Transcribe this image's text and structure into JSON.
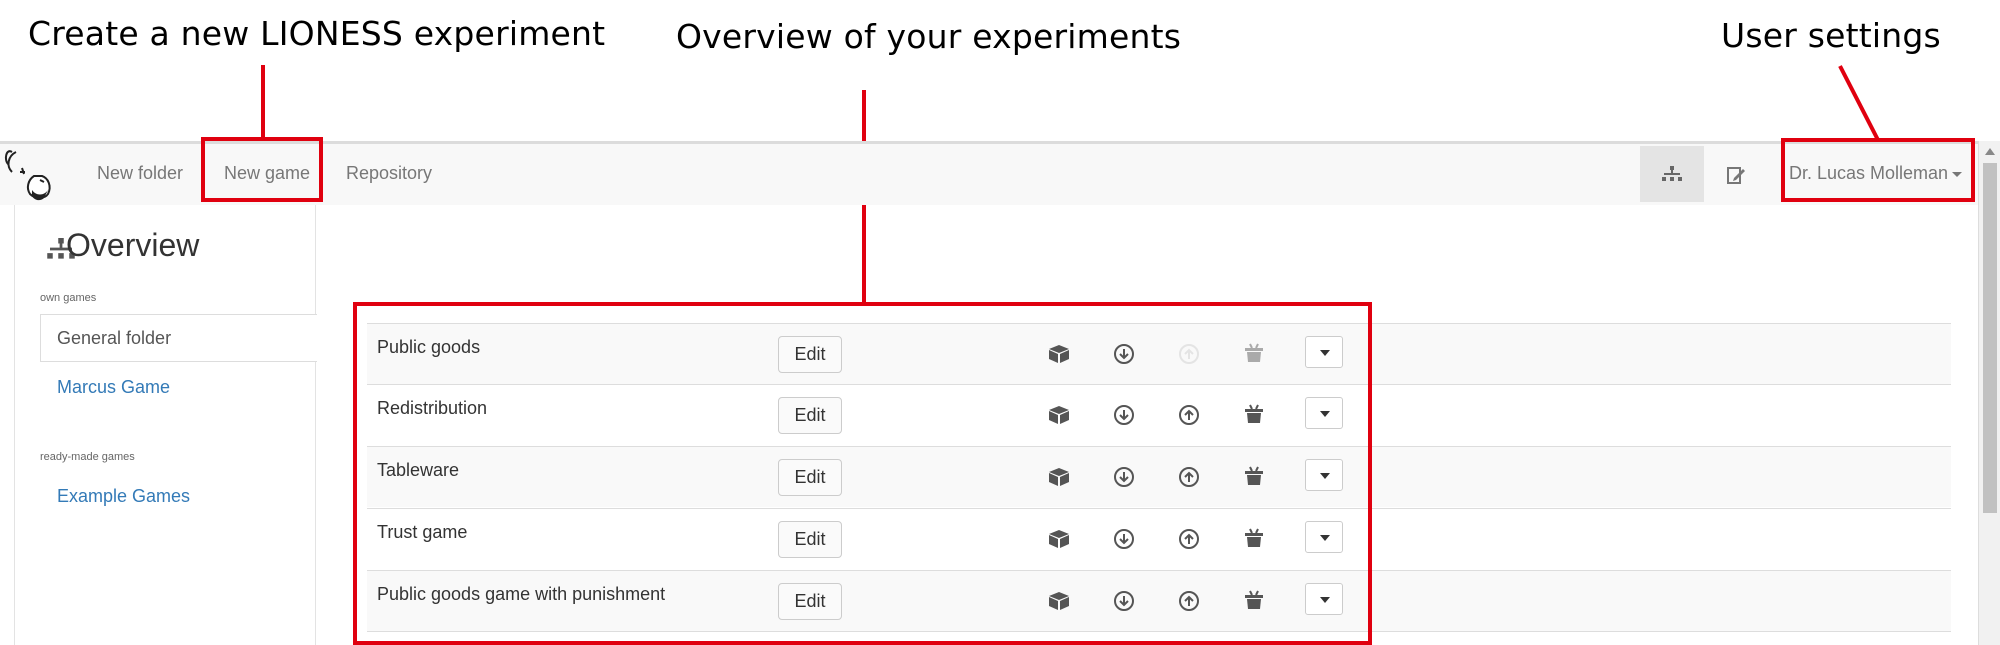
{
  "annotations": {
    "new_game": "Create a new LIONESS experiment",
    "overview": "Overview of your experiments",
    "user": "User settings"
  },
  "navbar": {
    "new_folder": "New folder",
    "new_game": "New game",
    "repository": "Repository",
    "user_name": "Dr. Lucas Molleman"
  },
  "sidebar": {
    "title": "Overview",
    "own_label": "own games",
    "own_folders": [
      "General folder",
      "Marcus Game"
    ],
    "ready_label": "ready-made games",
    "ready_folders": [
      "Example Games"
    ]
  },
  "games": {
    "edit_label": "Edit",
    "rows": [
      {
        "name": "Public goods"
      },
      {
        "name": "Redistribution"
      },
      {
        "name": "Tableware"
      },
      {
        "name": "Trust game"
      },
      {
        "name": "Public goods game with punishment"
      }
    ]
  },
  "colors": {
    "annotation_red": "#e0000f",
    "link_blue": "#337ab7"
  },
  "icons": [
    "lioness-logo",
    "sitemap-icon",
    "edit-note-icon",
    "box-icon",
    "download-icon",
    "upload-icon",
    "basket-icon"
  ]
}
